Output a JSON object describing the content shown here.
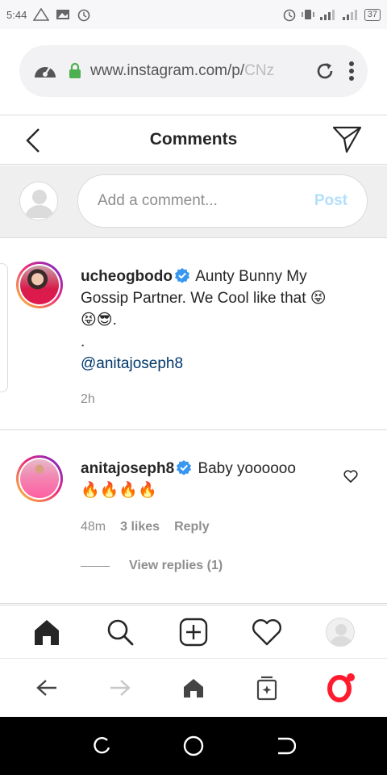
{
  "status_bar": {
    "time": "5:44",
    "battery": "37"
  },
  "browser": {
    "url_main": "www.instagram.com/p/",
    "url_faded": "CNz"
  },
  "header": {
    "title": "Comments"
  },
  "add_comment": {
    "placeholder": "Add a comment...",
    "post_label": "Post"
  },
  "comments": [
    {
      "username": "ucheogbodo",
      "text_line1": "Aunty Bunny My Gossip Partner. We Cool like that 😝",
      "text_line2": "😝😎.",
      "dot": ".",
      "mention": "@anitajoseph8",
      "time": "2h"
    },
    {
      "username": "anitajoseph8",
      "text_line1": "Baby yoooooo",
      "text_line2": "🔥🔥🔥🔥",
      "time": "48m",
      "likes": "3 likes",
      "reply_label": "Reply",
      "view_replies": "View replies (1)"
    }
  ],
  "icons": {
    "status_left": [
      "warning-icon",
      "image-icon",
      "alarm-icon"
    ],
    "status_right": [
      "alarm-icon",
      "vibrate-icon",
      "signal-icon",
      "signal-icon"
    ],
    "ig_nav": [
      "home-icon",
      "search-icon",
      "new-post-icon",
      "activity-heart-icon",
      "profile-avatar"
    ],
    "browser_nav": [
      "back-arrow-icon",
      "forward-arrow-icon",
      "home-icon",
      "tabs-icon",
      "opera-icon"
    ]
  },
  "colors": {
    "link": "#00376b",
    "post_disabled": "#b2dffc",
    "verified": "#3897f0",
    "opera_red": "#ff1b2d"
  }
}
